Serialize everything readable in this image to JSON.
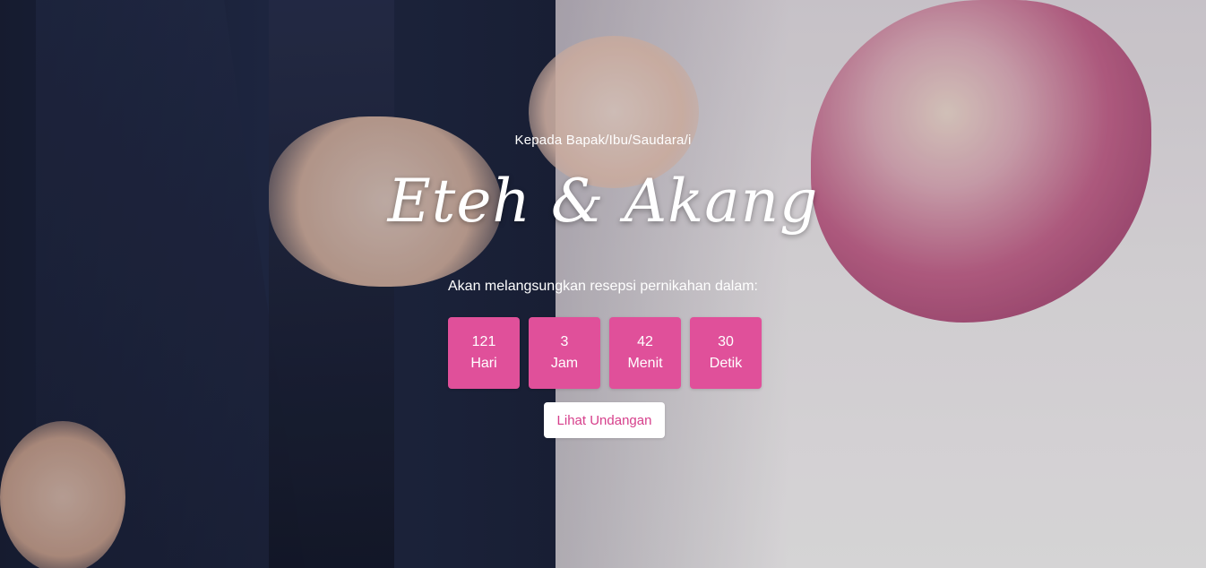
{
  "hero": {
    "greeting": "Kepada Bapak/Ibu/Saudara/i",
    "couple_names": "Eteh & Akang",
    "subtitle": "Akan melangsungkan resepsi pernikahan dalam:",
    "countdown": [
      {
        "value": "121",
        "unit": "Hari"
      },
      {
        "value": "3",
        "unit": "Jam"
      },
      {
        "value": "42",
        "unit": "Menit"
      },
      {
        "value": "30",
        "unit": "Detik"
      }
    ],
    "cta_label": "Lihat Undangan"
  },
  "colors": {
    "accent_pink": "#e0509a",
    "cta_text": "#d63f8b",
    "text_white": "#ffffff"
  },
  "background_image": "wedding-couple-photo"
}
